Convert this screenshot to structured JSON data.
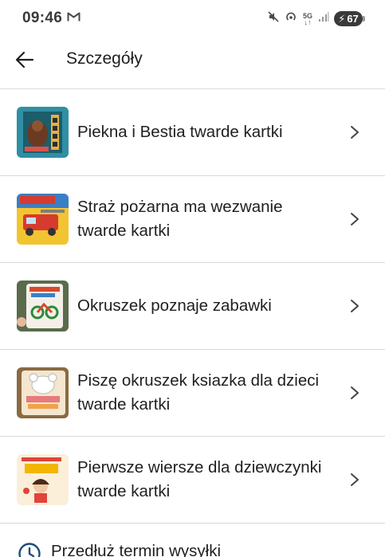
{
  "status_bar": {
    "time": "09:46",
    "left_icon": "gmail-icon",
    "network_label": "5G",
    "battery_level": "67",
    "icons": [
      "mute-icon",
      "hotspot-icon",
      "network-5g-icon",
      "signal-icon",
      "battery-charging-icon"
    ]
  },
  "app_bar": {
    "back_icon": "arrow-left-icon",
    "title": "Szczegóły"
  },
  "items": [
    {
      "title": "Piekna i Bestia twarde kartki",
      "thumb_colors": [
        "#2f8fa3",
        "#6a3b22",
        "#e2b04a"
      ]
    },
    {
      "title": "Straż pożarna ma wezwanie twarde kartki",
      "thumb_colors": [
        "#d63b2f",
        "#f3c431",
        "#3a7fc5"
      ]
    },
    {
      "title": "Okruszek poznaje zabawki",
      "thumb_colors": [
        "#f3f0ea",
        "#d64a2c",
        "#2c8a3a"
      ]
    },
    {
      "title": "Piszę okruszek ksiazka dla dzieci twarde kartki",
      "thumb_colors": [
        "#f4e6cf",
        "#e77a7a",
        "#8a6a42"
      ]
    },
    {
      "title": "Pierwsze wiersze dla dziewczynki twarde kartki",
      "thumb_colors": [
        "#fbefd9",
        "#e2433b",
        "#f2b600"
      ]
    }
  ],
  "footer_action": {
    "icon": "clock-icon",
    "label": "Przedłuż termin wysyłki"
  },
  "colors": {
    "divider": "#d9d9d9",
    "text": "#1f1f1f",
    "accent": "#1f4e79"
  }
}
